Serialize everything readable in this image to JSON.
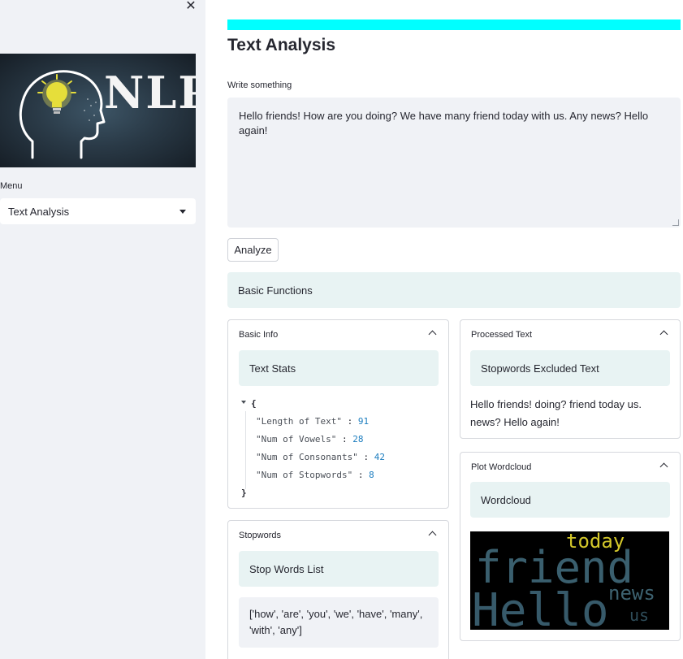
{
  "sidebar": {
    "close_label": "✕",
    "logo_text": "NLP",
    "menu_label": "Menu",
    "menu_selected": "Text Analysis"
  },
  "main": {
    "title": "Text Analysis",
    "input_label": "Write something",
    "input_value": "Hello friends! How are you doing? We have many friend today with us. Any news? Hello again!",
    "analyze_label": "Analyze",
    "basic_functions_label": "Basic Functions"
  },
  "basic_info": {
    "header": "Basic Info",
    "stats_label": "Text Stats",
    "json_open": "{",
    "json_close": "}",
    "stats": [
      {
        "key": "\"Length of Text\"",
        "value": "91"
      },
      {
        "key": "\"Num of Vowels\"",
        "value": "28"
      },
      {
        "key": "\"Num of Consonants\"",
        "value": "42"
      },
      {
        "key": "\"Num of Stopwords\"",
        "value": "8"
      }
    ]
  },
  "stopwords": {
    "header": "Stopwords",
    "list_label": "Stop Words List",
    "list_value": "['how', 'are', 'you', 'we', 'have', 'many', 'with', 'any']"
  },
  "processed_text": {
    "header": "Processed Text",
    "excluded_label": "Stopwords Excluded Text",
    "value": "Hello friends! doing? friend today us. news? Hello again!"
  },
  "wordcloud": {
    "header": "Plot Wordcloud",
    "label": "Wordcloud",
    "words": [
      {
        "text": "today",
        "color": "#d4c82a"
      },
      {
        "text": "friend",
        "color": "#3a5f6e"
      },
      {
        "text": "news",
        "color": "#3d6270"
      },
      {
        "text": "Hello",
        "color": "#375a6a"
      },
      {
        "text": "us",
        "color": "#2f4d5a"
      }
    ]
  },
  "colors": {
    "accent_progress": "#00ffff",
    "sidebar_bg": "#f0f2f6",
    "info_bg": "#e8f3f3"
  }
}
